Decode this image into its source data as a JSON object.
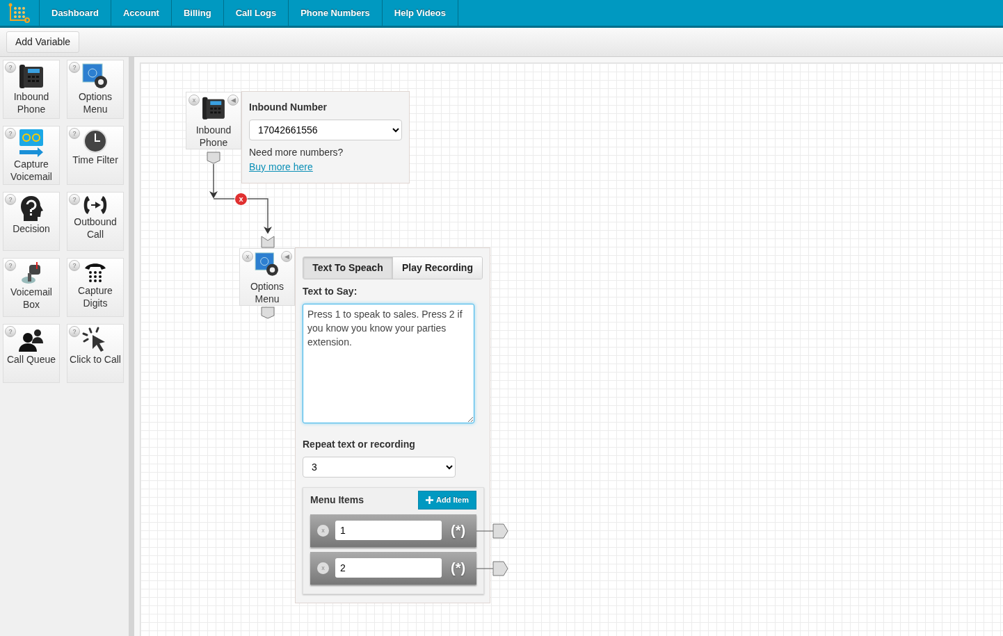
{
  "nav": {
    "items": [
      {
        "label": "Dashboard"
      },
      {
        "label": "Account"
      },
      {
        "label": "Billing"
      },
      {
        "label": "Call Logs"
      },
      {
        "label": "Phone Numbers"
      },
      {
        "label": "Help Videos"
      }
    ]
  },
  "toolbar": {
    "button": "Add Variable"
  },
  "palette": [
    {
      "kind": "phone",
      "label": "Inbound Phone",
      "help": "?"
    },
    {
      "kind": "menu",
      "label": "Options Menu",
      "help": "?"
    },
    {
      "kind": "voicemail",
      "label": "Capture Voicemail",
      "help": "?"
    },
    {
      "kind": "clock",
      "label": "Time Filter",
      "help": "?"
    },
    {
      "kind": "decision",
      "label": "Decision",
      "help": "?"
    },
    {
      "kind": "outbound",
      "label": "Outbound Call",
      "help": "?"
    },
    {
      "kind": "mailbox",
      "label": "Voicemail Box",
      "help": "?"
    },
    {
      "kind": "digits",
      "label": "Capture Digits",
      "help": "?"
    },
    {
      "kind": "queue",
      "label": "Call Queue",
      "help": "?"
    },
    {
      "kind": "click",
      "label": "Click to Call",
      "help": "?"
    }
  ],
  "canvas": {
    "connection": {
      "delete": "x"
    },
    "nodes": [
      {
        "kind": "inbound",
        "label": "Inbound Phone",
        "close": "x",
        "collapse": "◀",
        "panel": {
          "title": "Inbound Number",
          "number": "17042661556",
          "note": "Need more numbers?",
          "link": "Buy more here"
        }
      },
      {
        "kind": "menu",
        "label": "Options Menu",
        "close": "x",
        "collapse": "◀",
        "panel": {
          "tabs": [
            {
              "label": "Text To Speach",
              "selected": true
            },
            {
              "label": "Play Recording",
              "selected": false
            }
          ],
          "text_label": "Text to Say:",
          "text": "Press 1 to speak to sales. Press 2 if you know you know your parties extension.",
          "repeat_label": "Repeat text or recording",
          "repeat": "3",
          "menu_title": "Menu Items",
          "add_button": "Add Item",
          "items": [
            {
              "value": "1",
              "remove": "x",
              "badge": "(*)"
            },
            {
              "value": "2",
              "remove": "x",
              "badge": "(*)"
            }
          ]
        }
      }
    ]
  }
}
